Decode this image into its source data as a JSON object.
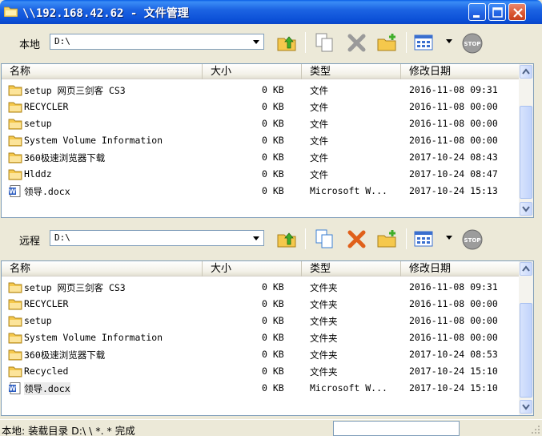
{
  "window": {
    "title": "\\\\192.168.42.62 - 文件管理"
  },
  "local": {
    "label": "本地",
    "path": "D:\\",
    "columns": {
      "name": "名称",
      "size": "大小",
      "type": "类型",
      "date": "修改日期"
    },
    "rows": [
      {
        "name": "setup 网页三剑客 CS3",
        "size": "0 KB",
        "type": "文件",
        "date": "2016-11-08 09:31",
        "icon": "folder"
      },
      {
        "name": "RECYCLER",
        "size": "0 KB",
        "type": "文件",
        "date": "2016-11-08 00:00",
        "icon": "folder"
      },
      {
        "name": "setup",
        "size": "0 KB",
        "type": "文件",
        "date": "2016-11-08 00:00",
        "icon": "folder"
      },
      {
        "name": "System Volume Information",
        "size": "0 KB",
        "type": "文件",
        "date": "2016-11-08 00:00",
        "icon": "folder"
      },
      {
        "name": "360极速浏览器下载",
        "size": "0 KB",
        "type": "文件",
        "date": "2017-10-24 08:43",
        "icon": "folder"
      },
      {
        "name": "Hlddz",
        "size": "0 KB",
        "type": "文件",
        "date": "2017-10-24 08:47",
        "icon": "folder"
      },
      {
        "name": "领导.docx",
        "size": "0 KB",
        "type": "Microsoft W...",
        "date": "2017-10-24 15:13",
        "icon": "word-doc"
      }
    ]
  },
  "remote": {
    "label": "远程",
    "path": "D:\\",
    "columns": {
      "name": "名称",
      "size": "大小",
      "type": "类型",
      "date": "修改日期"
    },
    "rows": [
      {
        "name": "setup 网页三剑客 CS3",
        "size": "0 KB",
        "type": "文件夹",
        "date": "2016-11-08 09:31",
        "icon": "folder"
      },
      {
        "name": "RECYCLER",
        "size": "0 KB",
        "type": "文件夹",
        "date": "2016-11-08 00:00",
        "icon": "folder"
      },
      {
        "name": "setup",
        "size": "0 KB",
        "type": "文件夹",
        "date": "2016-11-08 00:00",
        "icon": "folder"
      },
      {
        "name": "System Volume Information",
        "size": "0 KB",
        "type": "文件夹",
        "date": "2016-11-08 00:00",
        "icon": "folder"
      },
      {
        "name": "360极速浏览器下载",
        "size": "0 KB",
        "type": "文件夹",
        "date": "2017-10-24 08:53",
        "icon": "folder"
      },
      {
        "name": "Recycled",
        "size": "0 KB",
        "type": "文件夹",
        "date": "2017-10-24 15:10",
        "icon": "folder"
      },
      {
        "name": "领导.docx",
        "size": "0 KB",
        "type": "Microsoft W...",
        "date": "2017-10-24 15:10",
        "icon": "word-doc"
      }
    ]
  },
  "toolbar_icons": [
    "up-folder-icon",
    "copy-icon",
    "delete-icon",
    "new-folder-icon",
    "view-mode-icon",
    "stop-icon"
  ],
  "stop_label": "STOP",
  "status": {
    "text": "本地: 装载目录 D:\\ \\ *. * 完成"
  },
  "colors": {
    "titlebar": "#0A5FE6",
    "window_bg": "#ECE9D8",
    "folder": "#F5C84C",
    "delete": "#E0601A",
    "stop": "#8E8E8E"
  }
}
